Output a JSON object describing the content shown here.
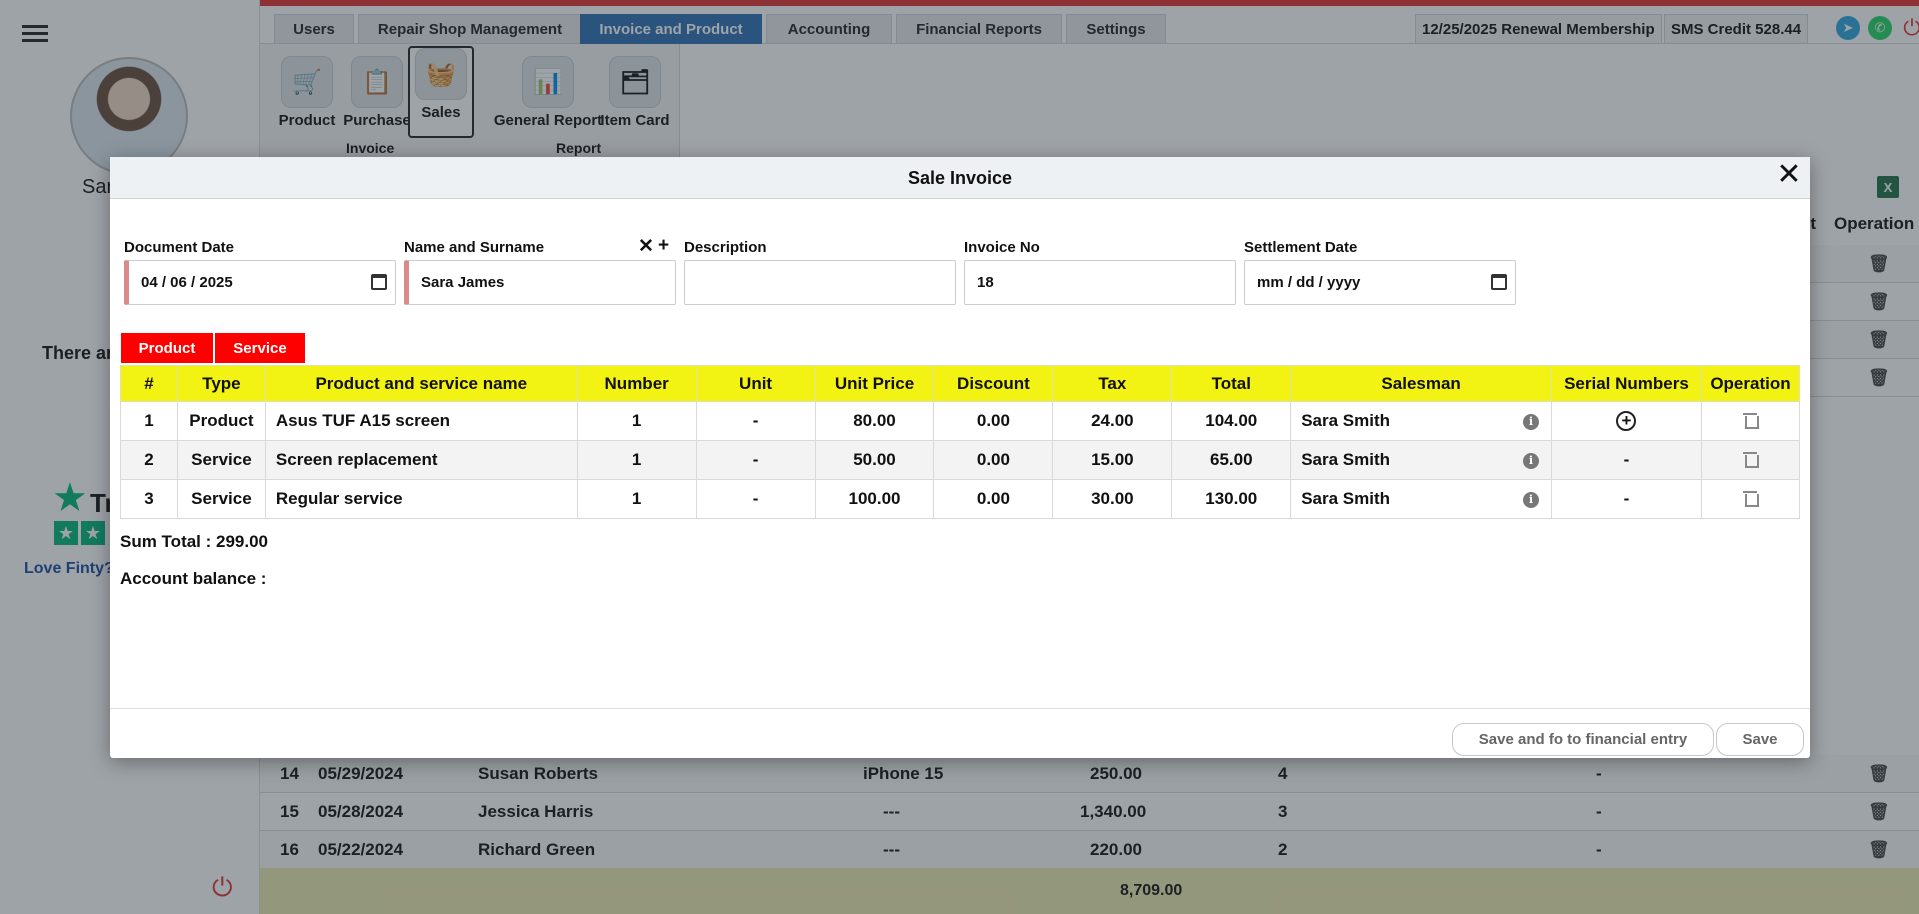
{
  "nav": {
    "tabs": [
      "Users",
      "Repair Shop Management",
      "Invoice and Product",
      "Accounting",
      "Financial Reports",
      "Settings"
    ],
    "membership": "12/25/2025 Renewal Membership",
    "sms_credit": "SMS Credit 528.44"
  },
  "ribbon": {
    "buttons": [
      "Product",
      "Purchase",
      "Sales",
      "General Report",
      "Item Card"
    ],
    "groups": [
      "Invoice",
      "Report"
    ]
  },
  "sidebar": {
    "user_name": "Sar",
    "empty_text": "There ar",
    "trustpilot_text": "Tr",
    "love_text": "Love Finty?"
  },
  "background_table": {
    "header_partial": "nt",
    "header_operation": "Operation",
    "rows": [
      {
        "no": "14",
        "date": "05/29/2024",
        "name": "Susan Roberts",
        "device": "iPhone 15",
        "amount": "250.00",
        "count": "4",
        "serial": "-"
      },
      {
        "no": "15",
        "date": "05/28/2024",
        "name": "Jessica Harris",
        "device": "---",
        "amount": "1,340.00",
        "count": "3",
        "serial": "-"
      },
      {
        "no": "16",
        "date": "05/22/2024",
        "name": "Richard Green",
        "device": "---",
        "amount": "220.00",
        "count": "2",
        "serial": "-"
      }
    ],
    "total": "8,709.00"
  },
  "modal": {
    "title": "Sale Invoice",
    "fields": {
      "document_date_label": "Document Date",
      "document_date_value": "04 / 06 / 2025",
      "name_label": "Name and Surname",
      "name_value": "Sara James",
      "description_label": "Description",
      "description_value": "",
      "invoice_no_label": "Invoice No",
      "invoice_no_value": "18",
      "settlement_label": "Settlement Date",
      "settlement_value": "mm / dd / yyyy"
    },
    "type_tabs": [
      "Product",
      "Service"
    ],
    "columns": [
      "#",
      "Type",
      "Product and service name",
      "Number",
      "Unit",
      "Unit Price",
      "Discount",
      "Tax",
      "Total",
      "Salesman",
      "Serial Numbers",
      "Operation"
    ],
    "rows": [
      {
        "no": "1",
        "type": "Product",
        "name": "Asus TUF A15 screen",
        "number": "1",
        "unit": "-",
        "unit_price": "80.00",
        "discount": "0.00",
        "tax": "24.00",
        "total": "104.00",
        "salesman": "Sara Smith",
        "serial": "+"
      },
      {
        "no": "2",
        "type": "Service",
        "name": "Screen replacement",
        "number": "1",
        "unit": "-",
        "unit_price": "50.00",
        "discount": "0.00",
        "tax": "15.00",
        "total": "65.00",
        "salesman": "Sara Smith",
        "serial": "-"
      },
      {
        "no": "3",
        "type": "Service",
        "name": "Regular service",
        "number": "1",
        "unit": "-",
        "unit_price": "100.00",
        "discount": "0.00",
        "tax": "30.00",
        "total": "130.00",
        "salesman": "Sara Smith",
        "serial": "-"
      }
    ],
    "sum_total": "Sum Total : 299.00",
    "account_balance": "Account balance :",
    "buttons": {
      "save_financial": "Save and fo to financial entry",
      "save": "Save"
    }
  },
  "colors": {
    "accent_blue": "#2d6eb5",
    "tab_red": "#ff0000",
    "header_yellow": "#f2f213",
    "top_red": "#e03030"
  }
}
